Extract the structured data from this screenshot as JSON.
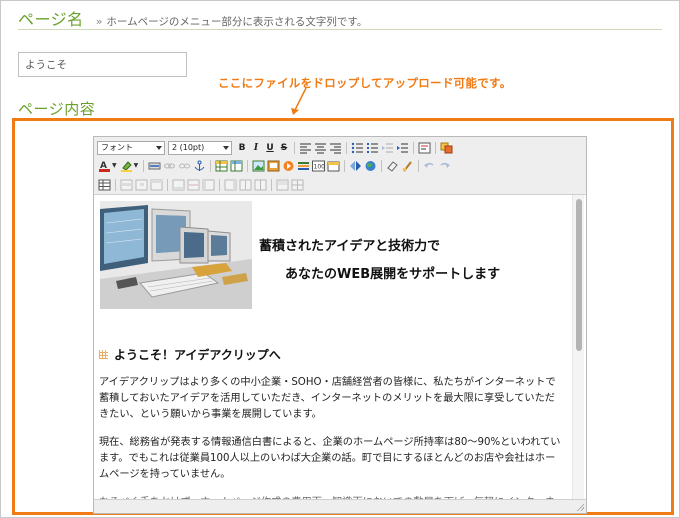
{
  "header": {
    "title": "ページ名",
    "separator": "»",
    "description": "ホームページのメニュー部分に表示される文字列です。"
  },
  "page_name_field": {
    "value": "ようこそ"
  },
  "drop_hint": "ここにファイルをドロップしてアップロード可能です。",
  "content_section": {
    "title": "ページ内容"
  },
  "editor": {
    "toolbar": {
      "font_select": "フォント",
      "size_select": "2 (10pt)",
      "bold": "B",
      "italic": "I",
      "underline": "U",
      "strike": "S"
    },
    "content": {
      "hero_line1": "蓄積されたアイデアと技術力で",
      "hero_line2": "あなたのWEB展開をサポートします",
      "welcome_heading": "ようこそ！アイデアクリップへ",
      "paragraph1": "アイデアクリップはより多くの中小企業・SOHO・店舗経営者の皆様に、私たちがインターネットで蓄積しておいたアイデアを活用していただき、インターネットのメリットを最大限に享受していただきたい、という願いから事業を展開しています。",
      "paragraph2": "現在、総務省が発表する情報通信白書によると、企業のホームページ所持率は80〜90%といわれています。でもこれは従業員100人以上のいわば大企業の話。町で目にするほとんどのお店や会社はホームページを持っていません。",
      "paragraph3": "なるべく手をかけず、ホームページ作成の費用面、知識面においての敷居を下げ、気軽にインターネットを利用できる環境を"
    }
  },
  "colors": {
    "accent_green": "#6aa12c",
    "drop_orange": "#f07a13"
  }
}
